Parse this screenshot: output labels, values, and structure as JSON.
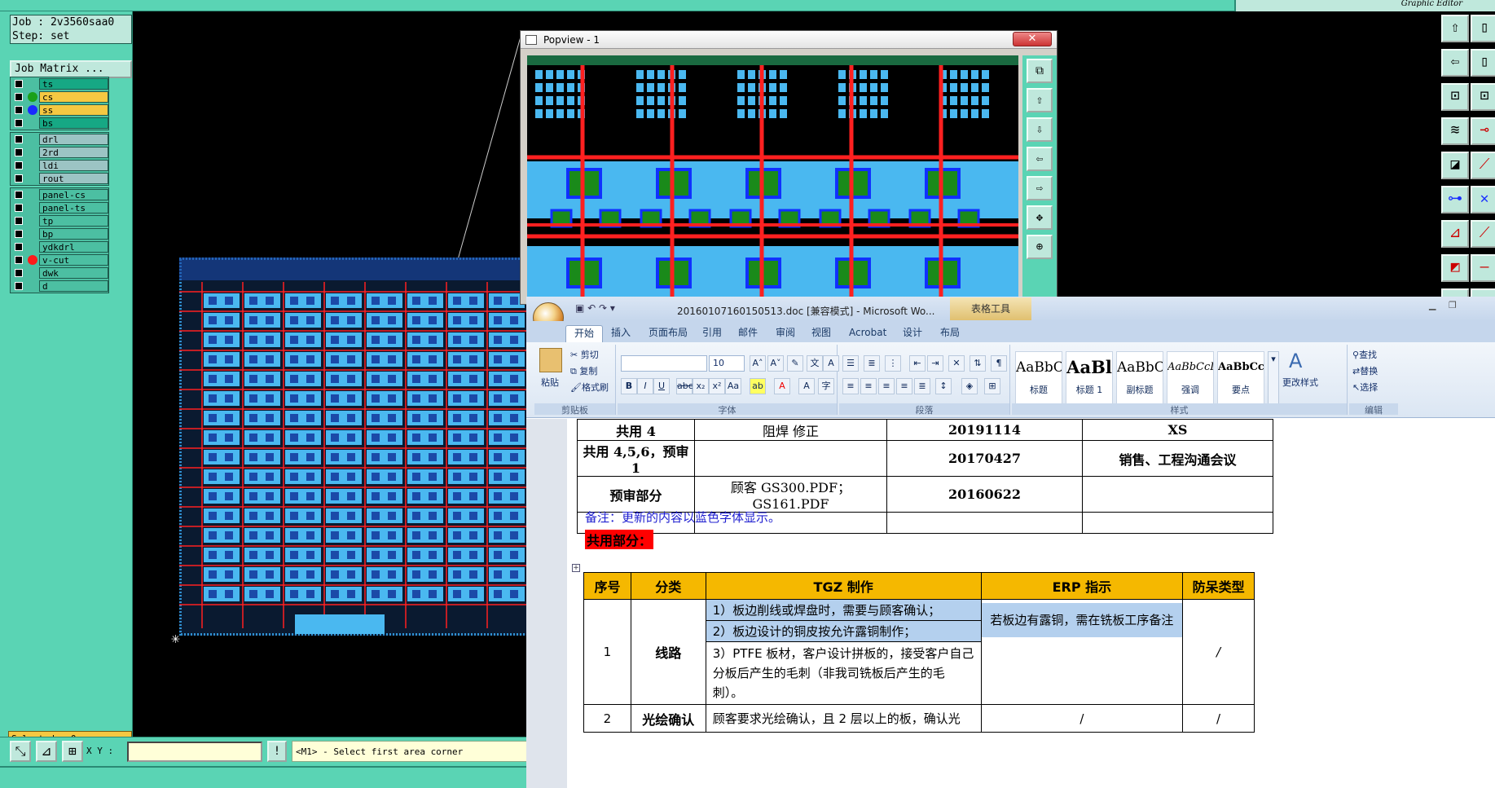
{
  "editor": {
    "title_right": "Graphic Editor",
    "job_label": "Job : 2v3560saa0",
    "step_label": "Step: set",
    "job_matrix_button": "Job Matrix ...",
    "layer_groups": [
      [
        {
          "name": "ts",
          "color": "#16a884",
          "dot": ""
        },
        {
          "name": "cs",
          "color": "#f5c842",
          "dot": "#1aa01a"
        },
        {
          "name": "ss",
          "color": "#f5c842",
          "dot": "#1a2aff"
        },
        {
          "name": "bs",
          "color": "#16a884",
          "dot": ""
        }
      ],
      [
        {
          "name": "drl",
          "color": "#9cc4c4",
          "dot": ""
        },
        {
          "name": "2rd",
          "color": "#9cc4c4",
          "dot": ""
        },
        {
          "name": "ldi",
          "color": "#9cc4c4",
          "dot": ""
        },
        {
          "name": "rout",
          "color": "#9cc4c4",
          "dot": ""
        }
      ],
      [
        {
          "name": "panel-cs",
          "color": "#4cbfa2",
          "dot": ""
        },
        {
          "name": "panel-ts",
          "color": "#4cbfa2",
          "dot": ""
        },
        {
          "name": "tp",
          "color": "#4cbfa2",
          "dot": ""
        },
        {
          "name": "bp",
          "color": "#4cbfa2",
          "dot": ""
        },
        {
          "name": "ydkdrl",
          "color": "#4cbfa2",
          "dot": ""
        },
        {
          "name": "v-cut",
          "color": "#4cbfa2",
          "dot": "#ff1a1a"
        },
        {
          "name": "dwk",
          "color": "#4cbfa2",
          "dot": ""
        },
        {
          "name": "d",
          "color": "#4cbfa2",
          "dot": ""
        }
      ]
    ],
    "selected_label": "Selected : 0",
    "xy_label": "X Y :",
    "xy_value": "",
    "prompt_message": "<M1> - Select first area corner",
    "prompt_button": "!"
  },
  "popview": {
    "title": "Popview - 1",
    "close": "✕"
  },
  "word": {
    "title": "20160107160150513.doc [兼容模式] - Microsoft Wo...",
    "table_tools": "表格工具",
    "tabs": [
      "开始",
      "插入",
      "页面布局",
      "引用",
      "邮件",
      "审阅",
      "视图",
      "Acrobat",
      "设计",
      "布局"
    ],
    "clipboard": {
      "paste": "粘贴",
      "cut": "剪切",
      "copy": "复制",
      "format_painter": "格式刷",
      "label": "剪贴板"
    },
    "font": {
      "name": "",
      "size": "10",
      "label": "字体"
    },
    "paragraph_label": "段落",
    "styles": [
      {
        "preview": "AaBbCcD",
        "name": "标题"
      },
      {
        "preview": "AaBl",
        "name": "标题 1"
      },
      {
        "preview": "AaBbC",
        "name": "副标题"
      },
      {
        "preview": "AaBbCcDa",
        "name": "强调"
      },
      {
        "preview": "AaBbCcD",
        "name": "要点"
      }
    ],
    "styles_label": "样式",
    "change_styles": "更改样式",
    "edit": {
      "find": "查找",
      "replace": "替换",
      "select": "选择",
      "label": "编辑"
    },
    "table1": [
      [
        "共用 4",
        "阻焊  修正",
        "20191114",
        "XS"
      ],
      [
        "共用 4,5,6，预审 1",
        "",
        "20170427",
        "销售、工程沟通会议"
      ],
      [
        "预审部分",
        "顾客 GS300.PDF；GS161.PDF",
        "20160622",
        ""
      ],
      [
        "",
        "",
        "",
        ""
      ]
    ],
    "note": "备注：更新的内容以蓝色字体显示。",
    "shared_heading": "共用部分：",
    "table2": {
      "headers": [
        "序号",
        "分类",
        "TGZ 制作",
        "ERP 指示",
        "防呆类型"
      ],
      "row1": {
        "no": "1",
        "category": "线路",
        "items": [
          "1）板边削线或焊盘时，需要与顾客确认；",
          "2）板边设计的铜皮按允许露铜制作；",
          "3）PTFE 板材，客户设计拼板的，接受客户自己分板后产生的毛刺（非我司铣板后产生的毛刺）。"
        ],
        "erp": "若板边有露铜，需在铣板工序备注",
        "type": "/"
      },
      "row2": {
        "no": "2",
        "category": "光绘确认",
        "item": "顾客要求光绘确认，且 2 层以上的板，确认光",
        "erp": "/",
        "type": "/"
      }
    }
  }
}
